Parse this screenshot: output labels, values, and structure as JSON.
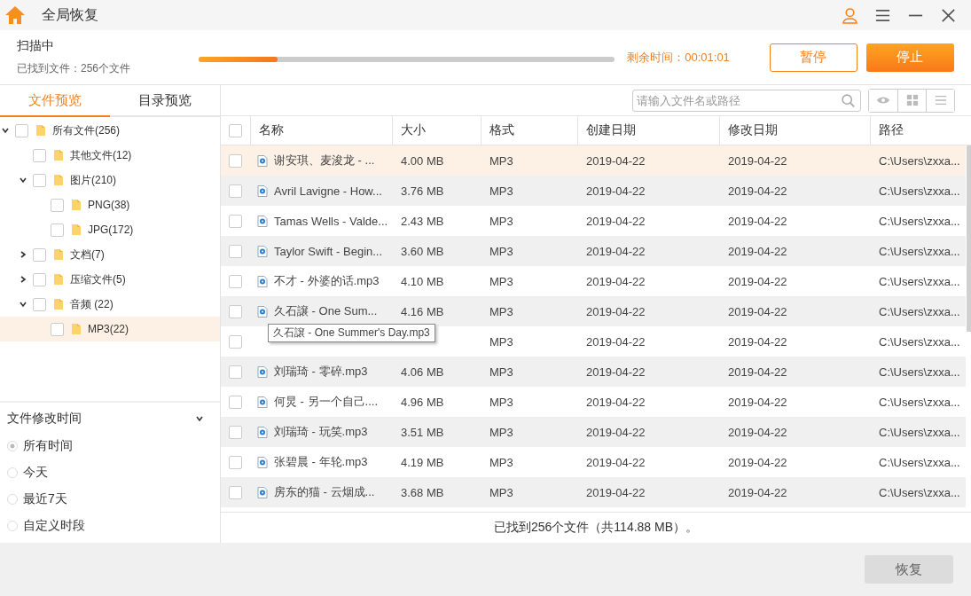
{
  "window": {
    "title": "全局恢复"
  },
  "scan": {
    "status": "扫描中",
    "found": "已找到文件：256个文件",
    "level": 0.19,
    "remaining": "剩余时间：00:01:01",
    "buttons": [
      {
        "label": "暂停",
        "kind": "outline"
      },
      {
        "label": "停止",
        "kind": "primary"
      }
    ]
  },
  "tabs": [
    {
      "label": "文件预览",
      "selected": true
    },
    {
      "label": "目录预览",
      "selected": false
    }
  ],
  "tree": [
    {
      "label": "所有文件(256)",
      "checked": false,
      "expanded": true,
      "selected": false,
      "children": [
        {
          "label": "其他文件(12)",
          "checked": false,
          "selected": false
        },
        {
          "label": "图片(210)",
          "checked": false,
          "expanded": true,
          "selected": false,
          "children": [
            {
              "label": "PNG(38)",
              "checked": false,
              "selected": false
            },
            {
              "label": "JPG(172)",
              "checked": false,
              "selected": false
            }
          ]
        },
        {
          "label": "文档(7)",
          "checked": false,
          "expanded": false,
          "selected": false
        },
        {
          "label": "压缩文件(5)",
          "checked": false,
          "expanded": false,
          "selected": false
        },
        {
          "label": "音频 (22)",
          "checked": false,
          "expanded": true,
          "selected": false,
          "children": [
            {
              "label": "MP3(22)",
              "checked": false,
              "selected": true
            }
          ]
        }
      ]
    }
  ],
  "filter": {
    "title": "文件修改时间",
    "options": [
      {
        "label": "所有时间",
        "selected": true
      },
      {
        "label": "今天",
        "selected": false
      },
      {
        "label": "最近7天",
        "selected": false
      },
      {
        "label": "自定义时段",
        "selected": false
      }
    ]
  },
  "search": {
    "placeholder": "请输入文件名或路径"
  },
  "table": {
    "select_all_checked": false,
    "columns": [
      "名称",
      "大小",
      "格式",
      "创建日期",
      "修改日期",
      "路径"
    ],
    "rows": [
      {
        "name": "谢安琪、麦浚龙 - ...",
        "size": "4.00 MB",
        "format": "MP3",
        "created": "2019-04-22",
        "modified": "2019-04-22",
        "path": "C:\\Users\\zxxa...",
        "selected": true,
        "checked": false
      },
      {
        "name": "Avril Lavigne - How...",
        "size": "3.76 MB",
        "format": "MP3",
        "created": "2019-04-22",
        "modified": "2019-04-22",
        "path": "C:\\Users\\zxxa...",
        "selected": false,
        "checked": false
      },
      {
        "name": "Tamas Wells - Valde...",
        "size": "2.43 MB",
        "format": "MP3",
        "created": "2019-04-22",
        "modified": "2019-04-22",
        "path": "C:\\Users\\zxxa...",
        "selected": false,
        "checked": false
      },
      {
        "name": "Taylor Swift - Begin...",
        "size": "3.60 MB",
        "format": "MP3",
        "created": "2019-04-22",
        "modified": "2019-04-22",
        "path": "C:\\Users\\zxxa...",
        "selected": false,
        "checked": false
      },
      {
        "name": "不才 - 外婆的话.mp3",
        "size": "4.10 MB",
        "format": "MP3",
        "created": "2019-04-22",
        "modified": "2019-04-22",
        "path": "C:\\Users\\zxxa...",
        "selected": false,
        "checked": false
      },
      {
        "name": "久石譲 - One Sum...",
        "size": "4.16 MB",
        "format": "MP3",
        "created": "2019-04-22",
        "modified": "2019-04-22",
        "path": "C:\\Users\\zxxa...",
        "selected": false,
        "checked": false
      },
      {
        "format": "MP3",
        "created": "2019-04-22",
        "modified": "2019-04-22",
        "path": "C:\\Users\\zxxa...",
        "selected": false,
        "checked": false
      },
      {
        "name": "刘瑞琦 - 零碎.mp3",
        "size": "4.06 MB",
        "format": "MP3",
        "created": "2019-04-22",
        "modified": "2019-04-22",
        "path": "C:\\Users\\zxxa...",
        "selected": false,
        "checked": false
      },
      {
        "name": "何炅 - 另一个自己....",
        "size": "4.96 MB",
        "format": "MP3",
        "created": "2019-04-22",
        "modified": "2019-04-22",
        "path": "C:\\Users\\zxxa...",
        "selected": false,
        "checked": false
      },
      {
        "name": "刘瑞琦 - 玩笑.mp3",
        "size": "3.51 MB",
        "format": "MP3",
        "created": "2019-04-22",
        "modified": "2019-04-22",
        "path": "C:\\Users\\zxxa...",
        "selected": false,
        "checked": false
      },
      {
        "name": "张碧晨 - 年轮.mp3",
        "size": "4.19 MB",
        "format": "MP3",
        "created": "2019-04-22",
        "modified": "2019-04-22",
        "path": "C:\\Users\\zxxa...",
        "selected": false,
        "checked": false
      },
      {
        "name": "房东的猫 - 云烟成...",
        "size": "3.68 MB",
        "format": "MP3",
        "created": "2019-04-22",
        "modified": "2019-04-22",
        "path": "C:\\Users\\zxxa...",
        "selected": false,
        "checked": false
      }
    ]
  },
  "tooltip": "久石譲 - One Summer's Day.mp3",
  "summary": "已找到256个文件（共114.88 MB）。",
  "restore_button": {
    "label": "恢复",
    "disabled": true
  }
}
